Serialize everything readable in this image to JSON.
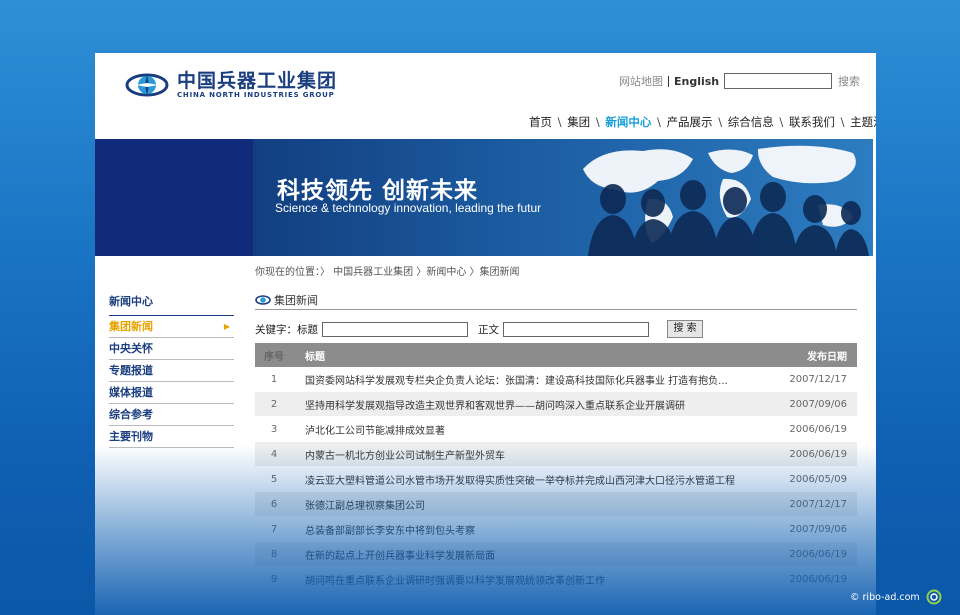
{
  "logo": {
    "cn": "中国兵器工业集团",
    "en": "CHINA NORTH INDUSTRIES GROUP"
  },
  "toplinks": {
    "sitemap": "网站地图",
    "english": "English",
    "search_label": "搜索"
  },
  "nav": [
    "首页",
    "集团",
    "新闻中心",
    "产品展示",
    "综合信息",
    "联系我们",
    "主题活动"
  ],
  "nav_active_index": 2,
  "banner": {
    "title": "科技领先  创新未来",
    "subtitle": "Science & technology innovation, leading the futur"
  },
  "breadcrumb": "你现在的位置：〉 中国兵器工业集团  〉新闻中心  〉集团新闻",
  "sidebar": {
    "title": "新闻中心",
    "items": [
      {
        "label": "集团新闻",
        "active": true
      },
      {
        "label": "中央关怀",
        "active": false
      },
      {
        "label": "专题报道",
        "active": false
      },
      {
        "label": "媒体报道",
        "active": false
      },
      {
        "label": "综合参考",
        "active": false
      },
      {
        "label": "主要刊物",
        "active": false
      }
    ]
  },
  "section": {
    "title": "集团新闻"
  },
  "search": {
    "keyword_label": "关键字：",
    "title_label": "标题",
    "body_label": "正文",
    "button": "搜 索"
  },
  "table": {
    "headers": [
      "序号",
      "标题",
      "发布日期"
    ],
    "rows": [
      [
        "1",
        "国资委网站科学发展观专栏央企负责人论坛：张国清：建设高科技国际化兵器事业  打造有抱负...",
        "2007/12/17"
      ],
      [
        "2",
        "坚持用科学发展观指导改造主观世界和客观世界——胡问鸣深入重点联系企业开展调研",
        "2007/09/06"
      ],
      [
        "3",
        "泸北化工公司节能减排成效显著",
        "2006/06/19"
      ],
      [
        "4",
        "内蒙古一机北方创业公司试制生产新型外贸车",
        "2006/06/19"
      ],
      [
        "5",
        "凌云亚大塑料管道公司水管市场开发取得实质性突破一举夺标并完成山西河津大口径污水管道工程",
        "2006/05/09"
      ],
      [
        "6",
        "张德江副总理视察集团公司",
        "2007/12/17"
      ],
      [
        "7",
        "总装备部副部长李安东中将到包头考察",
        "2007/09/06"
      ],
      [
        "8",
        "在新的起点上开创兵器事业科学发展新局面",
        "2006/06/19"
      ],
      [
        "9",
        "胡问鸣在重点联系企业调研时强调要以科学发展观统领改革创新工作",
        "2006/06/19"
      ]
    ]
  },
  "watermark": "© ribo-ad.com",
  "colors": {
    "brand_navy": "#1b3e7f",
    "nav_active": "#1aa0d8",
    "sidebar_active": "#e7a400",
    "table_header": "#8c8c8c"
  }
}
